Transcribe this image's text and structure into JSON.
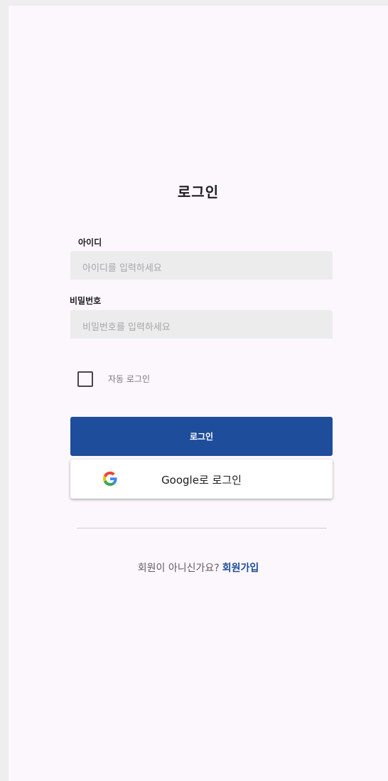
{
  "page": {
    "title": "로그인"
  },
  "form": {
    "id_label": "아이디",
    "id_placeholder": "아이디를 입력하세요",
    "password_label": "비밀번호",
    "password_placeholder": "비밀번호를 입력하세요",
    "auto_login_label": "자동 로그인",
    "auto_login_checked": false
  },
  "buttons": {
    "login_label": "로그인",
    "google_label": "Google로 로그인",
    "google_icon": "google-g-icon"
  },
  "signup": {
    "prompt": "회원이 아니신가요?",
    "link_label": "회원가입"
  },
  "colors": {
    "primary": "#1e4d9b",
    "background": "#fbf7fc",
    "input_fill": "#ececec"
  }
}
